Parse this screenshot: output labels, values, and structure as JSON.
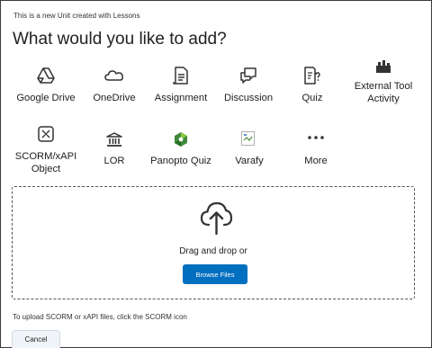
{
  "header": {
    "note": "This is a new Unit created with Lessons",
    "title": "What would you like to add?"
  },
  "tiles": [
    {
      "label": "Google Drive",
      "icon": "google-drive-icon"
    },
    {
      "label": "OneDrive",
      "icon": "onedrive-icon"
    },
    {
      "label": "Assignment",
      "icon": "assignment-icon"
    },
    {
      "label": "Discussion",
      "icon": "discussion-icon"
    },
    {
      "label": "Quiz",
      "icon": "quiz-icon"
    },
    {
      "label": "External Tool Activity",
      "icon": "external-tool-icon"
    },
    {
      "label": "SCORM/xAPI Object",
      "icon": "scorm-icon"
    },
    {
      "label": "LOR",
      "icon": "lor-icon"
    },
    {
      "label": "Panopto Quiz",
      "icon": "panopto-icon"
    },
    {
      "label": "Varafy",
      "icon": "varafy-icon"
    },
    {
      "label": "More",
      "icon": "more-icon"
    }
  ],
  "dropzone": {
    "text": "Drag and drop or",
    "button": "Browse Files",
    "icon": "cloud-upload-icon"
  },
  "footer": {
    "hint": "To upload SCORM or xAPI files, click the SCORM icon",
    "cancel": "Cancel"
  },
  "colors": {
    "primary": "#006fbf",
    "panopto_green": "#3f8a3a"
  }
}
